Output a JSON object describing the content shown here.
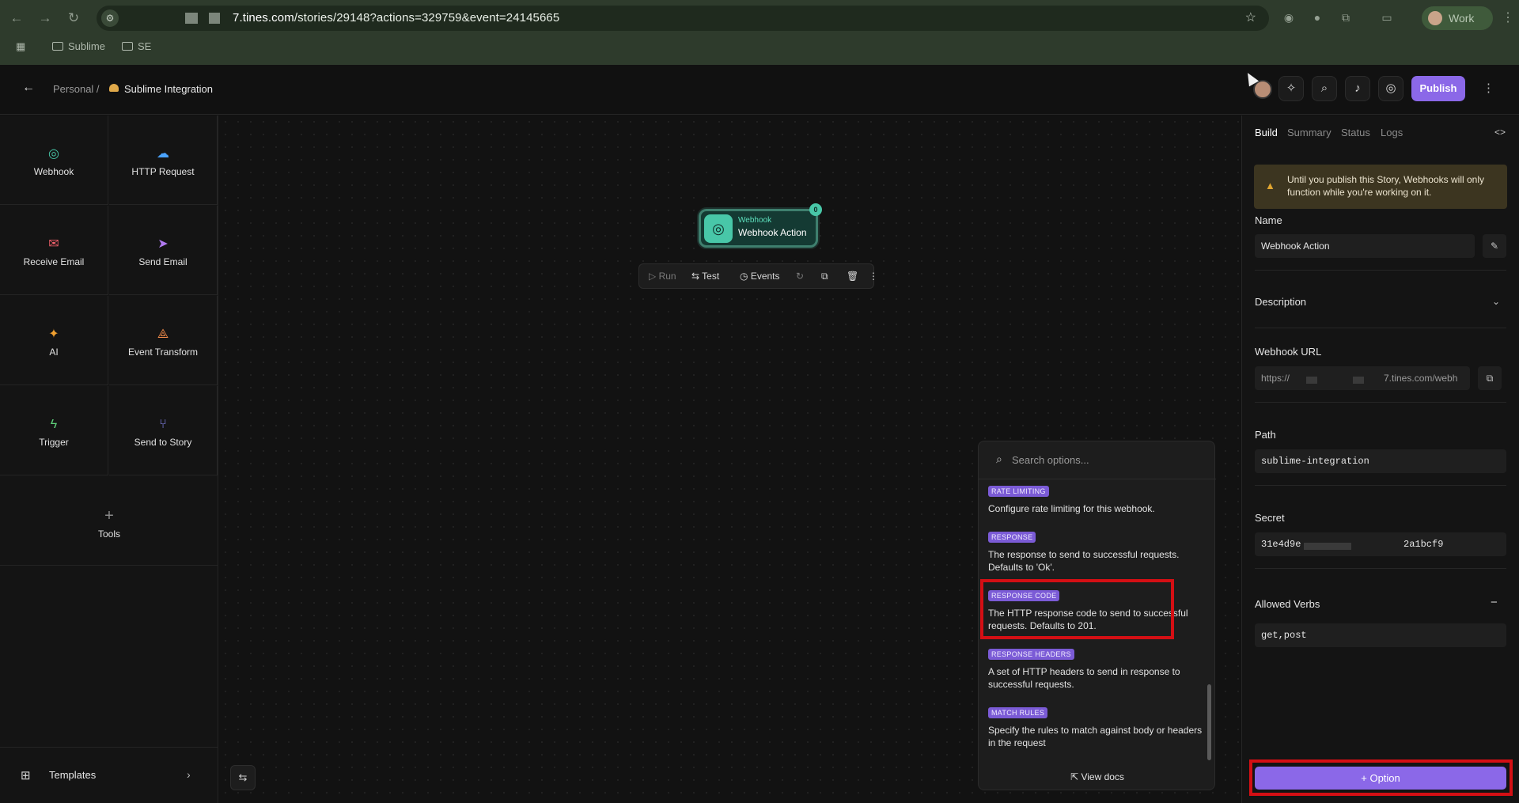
{
  "browser": {
    "url_host_suffix": "7.tines.com",
    "url_path": "/stories/29148?actions=329759&event=24145665",
    "profile_label": "Work",
    "bookmarks": [
      "Sublime",
      "SE"
    ]
  },
  "header": {
    "breadcrumb_parent": "Personal /",
    "story_title": "Sublime Integration",
    "publish_label": "Publish"
  },
  "palette": {
    "tiles": [
      {
        "label": "Webhook",
        "icon": "webhook-icon",
        "color": "#48c7a8"
      },
      {
        "label": "HTTP Request",
        "icon": "cloud-icon",
        "color": "#4aa3ff"
      },
      {
        "label": "Receive Email",
        "icon": "mail-icon",
        "color": "#f0606a"
      },
      {
        "label": "Send Email",
        "icon": "send-icon",
        "color": "#b07af0"
      },
      {
        "label": "AI",
        "icon": "sparkle-icon",
        "color": "#f0a030"
      },
      {
        "label": "Event Transform",
        "icon": "transform-icon",
        "color": "#f08a4a"
      },
      {
        "label": "Trigger",
        "icon": "bolt-icon",
        "color": "#5fd07a"
      },
      {
        "label": "Send to Story",
        "icon": "branch-icon",
        "color": "#8a8af5"
      }
    ],
    "tools_label": "Tools",
    "templates_label": "Templates"
  },
  "canvas": {
    "node": {
      "type": "Webhook",
      "name": "Webhook Action",
      "badge": "0"
    },
    "toolbar": {
      "run": "Run",
      "test": "Test",
      "events": "Events"
    }
  },
  "dropdown": {
    "search_placeholder": "Search options...",
    "items": [
      {
        "tag": "RATE LIMITING",
        "desc": "Configure rate limiting for this webhook."
      },
      {
        "tag": "RESPONSE",
        "desc": "The response to send to successful requests. Defaults to 'Ok'."
      },
      {
        "tag": "RESPONSE CODE",
        "desc": "The HTTP response code to send to successful requests. Defaults to 201."
      },
      {
        "tag": "RESPONSE HEADERS",
        "desc": "A set of HTTP headers to send in response to successful requests."
      },
      {
        "tag": "MATCH RULES",
        "desc": "Specify the rules to match against body or headers in the request"
      }
    ],
    "view_docs": "View docs"
  },
  "panel": {
    "tabs": [
      "Build",
      "Summary",
      "Status",
      "Logs"
    ],
    "active_tab": "Build",
    "warning": "Until you publish this Story, Webhooks will only function while you're working on it.",
    "name_label": "Name",
    "name_value": "Webhook Action",
    "description_label": "Description",
    "webhook_url_label": "Webhook URL",
    "webhook_url_prefix": "https://",
    "webhook_url_suffix": "7.tines.com/webh",
    "path_label": "Path",
    "path_value": "sublime-integration",
    "secret_label": "Secret",
    "secret_prefix": "31e4d9e",
    "secret_suffix": "2a1bcf9",
    "verbs_label": "Allowed Verbs",
    "verbs_value": "get,post",
    "option_button": "Option"
  },
  "colors": {
    "accent": "#8b68e8",
    "highlight": "#d40f14",
    "webhook": "#48c7a8"
  }
}
